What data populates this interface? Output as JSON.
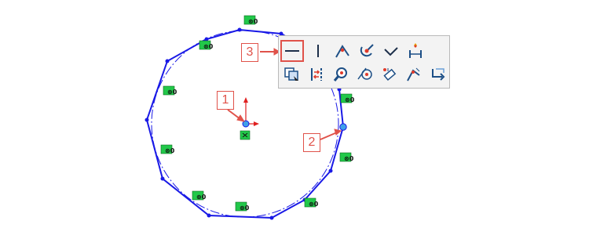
{
  "callouts": {
    "c1": "1",
    "c2": "2",
    "c3": "3"
  },
  "relation_marker_text": "⊗0",
  "toolbar": {
    "row1": [
      "horizontal",
      "vertical",
      "coincident",
      "merge",
      "perpendicular",
      "fix"
    ],
    "row2": [
      "copy",
      "collinear",
      "concentric",
      "tangent",
      "equal",
      "midpoint",
      "undo"
    ],
    "selected": "horizontal"
  },
  "colors": {
    "sketch": "#1919e6",
    "construction": "#1919e6",
    "callout": "#e0524a",
    "origin_arrow": "#e02020",
    "marker_bg": "#22c84a",
    "point_fill": "#3fa0e8",
    "toolbar_bg": "#f3f3f3",
    "toolbar_border": "#b9b9b9",
    "icon_primary": "#1d4f86",
    "icon_accent": "#e03a2a"
  }
}
